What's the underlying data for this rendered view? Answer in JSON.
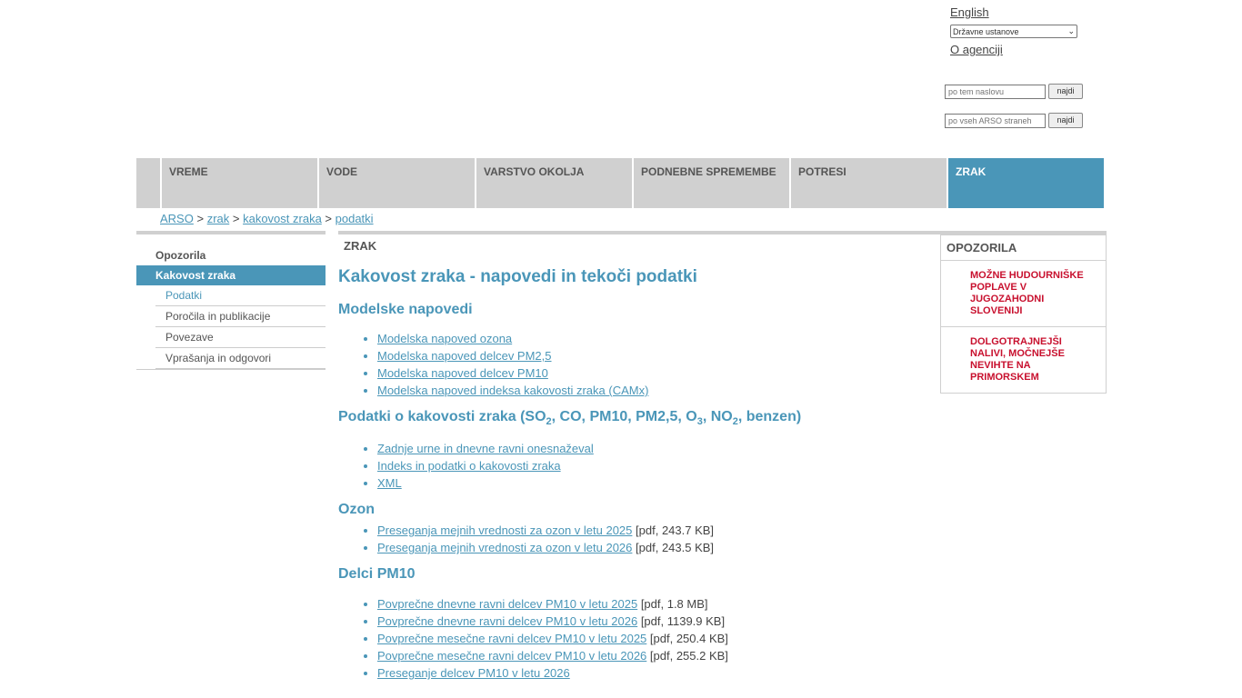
{
  "header": {
    "language_link": "English",
    "institutions_select": "Državne ustanove",
    "about_link": "O agenciji",
    "search_topic_placeholder": "po tem naslovu",
    "search_all_placeholder": "po vseh ARSO straneh",
    "search_button": "najdi"
  },
  "nav": {
    "tabs": [
      {
        "label": "VREME"
      },
      {
        "label": "VODE"
      },
      {
        "label": "VARSTVO OKOLJA"
      },
      {
        "label": "PODNEBNE SPREMEMBE"
      },
      {
        "label": "POTRESI"
      },
      {
        "label": "ZRAK"
      }
    ]
  },
  "breadcrumb": {
    "items": [
      "ARSO",
      "zrak",
      "kakovost zraka",
      "podatki"
    ],
    "separator": ">"
  },
  "sidebar": {
    "items": [
      "Opozorila",
      "Kakovost zraka"
    ],
    "subitems": [
      "Podatki",
      "Poročila in publikacije",
      "Povezave",
      "Vprašanja in odgovori"
    ]
  },
  "main": {
    "section_label": "ZRAK",
    "title": "Kakovost zraka - napovedi in tekoči podatki",
    "sections": [
      {
        "heading": "Modelske napovedi",
        "links": [
          {
            "text": "Modelska napoved ozona"
          },
          {
            "text": "Modelska napoved delcev PM2,5"
          },
          {
            "text": "Modelska napoved delcev PM10"
          },
          {
            "text": "Modelska napoved indeksa kakovosti zraka (CAMx)"
          }
        ]
      },
      {
        "heading_parts": [
          "Podatki o kakovosti zraka (SO",
          "2",
          ", CO, PM10, PM2,5, O",
          "3",
          ", NO",
          "2",
          ", benzen)"
        ],
        "links": [
          {
            "text": "Zadnje urne in dnevne ravni onesnaževal"
          },
          {
            "text": "Indeks in podatki o kakovosti zraka"
          },
          {
            "text": "XML"
          }
        ]
      },
      {
        "heading": "Ozon",
        "links": [
          {
            "text": "Preseganja mejnih vrednosti za ozon v letu 2025",
            "meta": "[pdf, 243.7 KB]"
          },
          {
            "text": "Preseganja mejnih vrednosti za ozon v letu 2026",
            "meta": "[pdf, 243.5 KB]"
          }
        ]
      },
      {
        "heading": "Delci PM10",
        "links": [
          {
            "text": "Povprečne dnevne ravni delcev PM10 v letu 2025",
            "meta": "[pdf, 1.8 MB]"
          },
          {
            "text": "Povprečne dnevne ravni delcev PM10 v letu 2026",
            "meta": "[pdf, 1139.9 KB]"
          },
          {
            "text": "Povprečne mesečne ravni delcev PM10 v letu 2025",
            "meta": "[pdf, 250.4 KB]"
          },
          {
            "text": "Povprečne mesečne ravni delcev PM10 v letu 2026",
            "meta": "[pdf, 255.2 KB]"
          },
          {
            "text": "Preseganje delcev PM10 v letu 2026"
          }
        ]
      }
    ]
  },
  "alerts": {
    "title": "OPOZORILA",
    "items": [
      "MOŽNE HUDOURNIŠKE POPLAVE V JUGOZAHODNI SLOVENIJI",
      "DOLGOTRAJNEJŠI NALIVI, MOČNEJŠE NEVIHTE NA PRIMORSKEM"
    ]
  },
  "colors": {
    "accent": "#4a96b8",
    "nav_bg": "#d0d0d0",
    "alert": "#c8102e"
  }
}
